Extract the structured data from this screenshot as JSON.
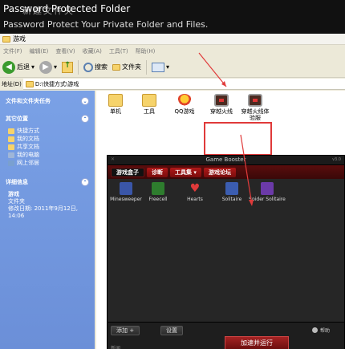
{
  "banner": {
    "title": "Password Protected Folder",
    "overlay_text": "新建文件夹",
    "subtitle": "Password Protect Your Private Folder and Files."
  },
  "explorer": {
    "window_title": "游戏",
    "menu": [
      "文件(F)",
      "编辑(E)",
      "查看(V)",
      "收藏(A)",
      "工具(T)",
      "帮助(H)"
    ],
    "toolbar": {
      "back": "后退",
      "search": "搜索",
      "folders": "文件夹"
    },
    "address": {
      "label": "地址(D)",
      "path": "D:\\快捷方式\\游戏"
    },
    "left": {
      "tasks_title": "文件和文件夹任务",
      "places_title": "其它位置",
      "places": [
        {
          "label": "快捷方式",
          "color": "#f6d36b"
        },
        {
          "label": "我的文档",
          "color": "#f6d36b"
        },
        {
          "label": "共享文档",
          "color": "#f6d36b"
        },
        {
          "label": "我的电脑",
          "color": "#9fb6d8"
        },
        {
          "label": "网上邻居",
          "color": "#7aa0d0"
        }
      ],
      "details_title": "详细信息",
      "details": {
        "name": "游戏",
        "type": "文件夹",
        "modified": "修改日期: 2011年9月12日, 14:06"
      }
    },
    "files": [
      {
        "label": "单机",
        "kind": "folder"
      },
      {
        "label": "工具",
        "kind": "folder"
      },
      {
        "label": "QQ游戏",
        "kind": "qq"
      },
      {
        "label": "穿越火线",
        "kind": "chest"
      },
      {
        "label": "穿越火线体验服",
        "kind": "chest"
      }
    ]
  },
  "game_booster": {
    "title": "Game Booster",
    "version": "v3.0",
    "tabs": [
      "游戏盒子",
      "诊断",
      "工具集 ▾",
      "游戏论坛"
    ],
    "games": [
      {
        "label": "Minesweeper",
        "color": "#3a56a8"
      },
      {
        "label": "Freecell",
        "color": "#2e7d2e"
      },
      {
        "label": "Hearts",
        "color": "#c73a3a"
      },
      {
        "label": "Solitaire",
        "color": "#3b5db0"
      },
      {
        "label": "Spider Solitaire",
        "color": "#6b3aa8"
      }
    ],
    "add_button": "添加 +",
    "settings_button": "设置",
    "help_label": "帮助",
    "accelerate_button": "加速并运行",
    "status": "新闻"
  }
}
